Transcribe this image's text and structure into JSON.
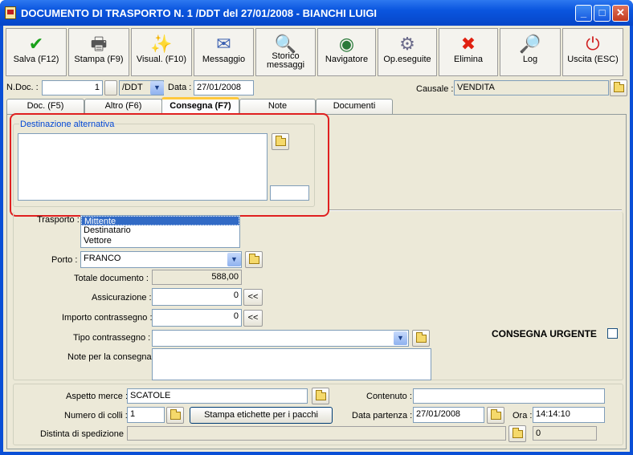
{
  "window": {
    "title": "DOCUMENTO DI TRASPORTO N. 1 /DDT del 27/01/2008 - BIANCHI LUIGI",
    "min": "_",
    "max": "□",
    "close": "✕"
  },
  "toolbar": [
    {
      "name": "save",
      "label": "Salva (F12)",
      "icon": "✔",
      "color": "#1aa11a"
    },
    {
      "name": "print",
      "label": "Stampa (F9)",
      "icon": "🖶",
      "color": "#555555"
    },
    {
      "name": "preview",
      "label": "Visual. (F10)",
      "icon": "✨",
      "color": "#7a5a20"
    },
    {
      "name": "message",
      "label": "Messaggio",
      "icon": "✉",
      "color": "#3a5fb0"
    },
    {
      "name": "history",
      "label": "Storico messaggi",
      "icon": "🔍",
      "color": "#3a5fb0"
    },
    {
      "name": "browser",
      "label": "Navigatore",
      "icon": "◉",
      "color": "#2a7a3a"
    },
    {
      "name": "operations",
      "label": "Op.eseguite",
      "icon": "⚙",
      "color": "#6a6a8a"
    },
    {
      "name": "delete",
      "label": "Elimina",
      "icon": "✖",
      "color": "#e02010"
    },
    {
      "name": "log",
      "label": "Log",
      "icon": "🔎",
      "color": "#2a60c0"
    },
    {
      "name": "exit",
      "label": "Uscita (ESC)",
      "icon": "⏻",
      "color": "#d02020"
    }
  ],
  "header": {
    "ndoc_label": "N.Doc. :",
    "ndoc_value": "1",
    "series_value": "/DDT",
    "date_label": "Data :",
    "date_value": "27/01/2008",
    "causale_label": "Causale :",
    "causale_value": "VENDITA"
  },
  "tabs": [
    "Doc. (F5)",
    "Altro (F6)",
    "Consegna (F7)",
    "Note",
    "Documenti"
  ],
  "destinazione": {
    "legend": "Destinazione alternativa",
    "text": "",
    "small": ""
  },
  "trasporto": {
    "label": "Trasporto :",
    "options": [
      "Mittente",
      "Destinatario",
      "Vettore"
    ],
    "selected": "Mittente"
  },
  "porto": {
    "label": "Porto :",
    "value": "FRANCO"
  },
  "totale": {
    "label": "Totale documento :",
    "value": "588,00"
  },
  "assicurazione": {
    "label": "Assicurazione :",
    "value": "0",
    "button": "<<"
  },
  "contrassegno": {
    "label": "Importo contrassegno :",
    "value": "0",
    "button": "<<"
  },
  "tipo_contrassegno": {
    "label": "Tipo contrassegno :",
    "value": ""
  },
  "note_consegna": {
    "label": "Note per la consegna",
    "value": ""
  },
  "urgente": {
    "label": "CONSEGNA URGENTE",
    "checked": false
  },
  "bottom": {
    "aspetto_label": "Aspetto merce :",
    "aspetto_value": "SCATOLE",
    "contenuto_label": "Contenuto :",
    "contenuto_value": "",
    "colli_label": "Numero di colli :",
    "colli_value": "1",
    "etichette_button": "Stampa etichette per i pacchi",
    "partenza_label": "Data partenza :",
    "partenza_value": "27/01/2008",
    "ora_label": "Ora :",
    "ora_value": "14:14:10",
    "distinta_label": "Distinta di spedizione :",
    "distinta_value": "",
    "distinta_num": "0"
  },
  "colors": {
    "title": "#0a55df",
    "highlight": "#e02020",
    "selection": "#316ac5"
  }
}
